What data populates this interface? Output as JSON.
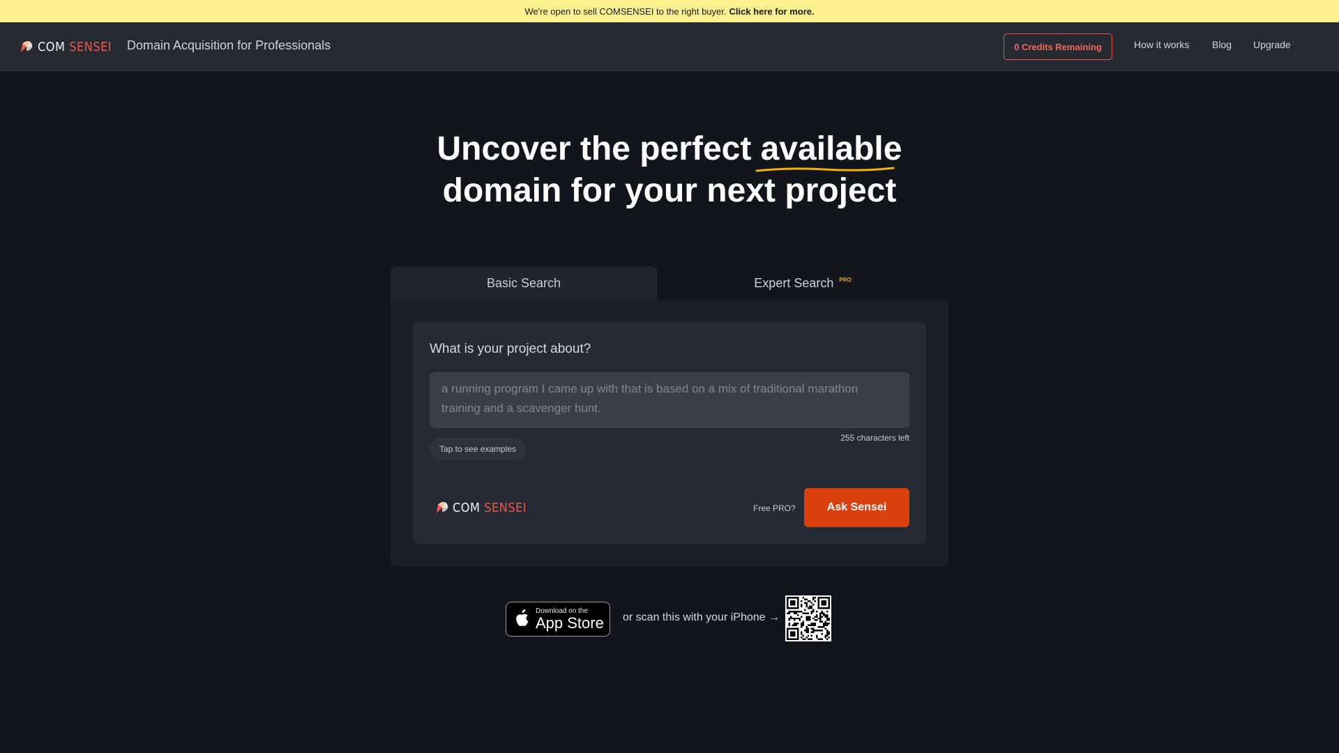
{
  "banner": {
    "text": "We're open to sell COMSENSEI to the right buyer.",
    "link": "Click here for more."
  },
  "nav": {
    "logo": {
      "com": "COM",
      "sensei": "SENSEI"
    },
    "tagline": "Domain Acquisition for Professionals",
    "credits_button": "0 Credits Remaining",
    "links": [
      "How it works",
      "Blog",
      "Upgrade"
    ]
  },
  "hero": {
    "line1_before": "Uncover the perfect",
    "line1_highlight": "available",
    "line2": "domain for your next project",
    "highlight_color": "#f5b301"
  },
  "tabs": {
    "basic": "Basic Search",
    "expert": "Expert Search",
    "expert_badge": "PRO"
  },
  "form": {
    "question": "What is your project about?",
    "placeholder": "a running program I came up with that is based on a mix of traditional marathon training and a scavenger hunt.",
    "chars_left": "255 characters left",
    "examples_button": "Tap to see examples",
    "logo": {
      "com": "COM",
      "sensei": "SENSEI"
    },
    "free_pro": "Free PRO?",
    "submit": "Ask Sensei"
  },
  "app": {
    "store_small": "Download on the",
    "store_big": "App Store",
    "scan_text": "or scan this with your iPhone →"
  },
  "colors": {
    "accent": "#d9400e",
    "brand_red": "#f0574a",
    "banner_bg": "#fdf08e"
  }
}
